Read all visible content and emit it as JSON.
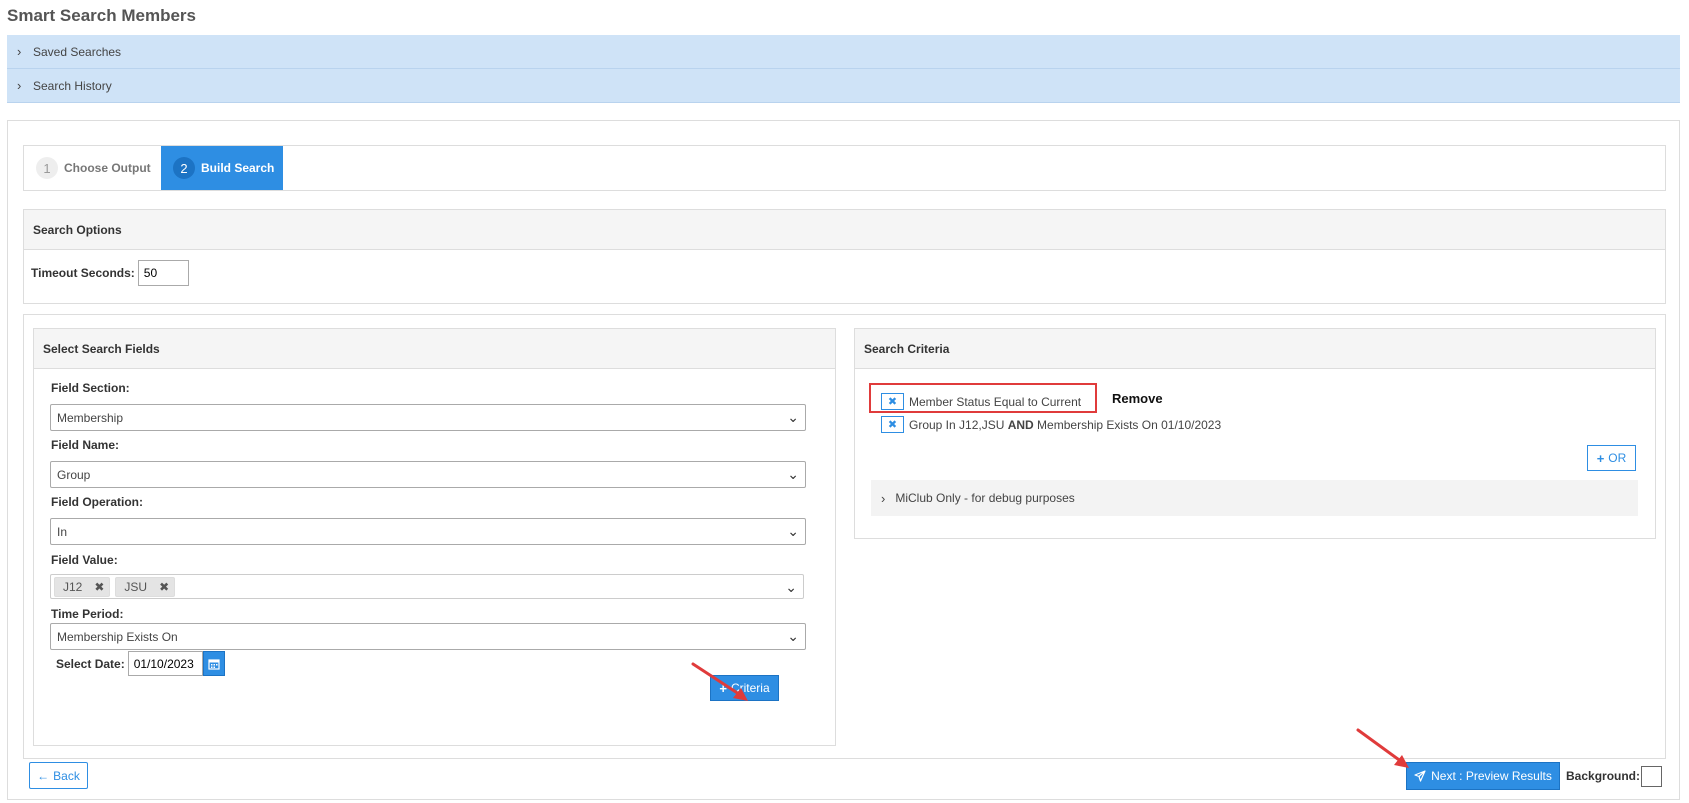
{
  "page": {
    "title": "Smart Search Members"
  },
  "accordions": [
    {
      "label": "Saved Searches"
    },
    {
      "label": "Search History"
    }
  ],
  "wizard": {
    "steps": [
      {
        "num": "1",
        "label": "Choose Output"
      },
      {
        "num": "2",
        "label": "Build Search"
      }
    ]
  },
  "search_options": {
    "title": "Search Options",
    "timeout_label": "Timeout Seconds:",
    "timeout_value": "50"
  },
  "fields": {
    "title": "Select Search Fields",
    "section_label": "Field Section:",
    "section_value": "Membership",
    "name_label": "Field Name:",
    "name_value": "Group",
    "operation_label": "Field Operation:",
    "operation_value": "In",
    "value_label": "Field Value:",
    "value_tags": [
      "J12",
      "JSU"
    ],
    "period_label": "Time Period:",
    "period_value": "Membership Exists On",
    "date_label": "Select Date:",
    "date_value": "01/10/2023",
    "criteria_button": "Criteria"
  },
  "criteria": {
    "title": "Search Criteria",
    "item1": "Member Status Equal to Current",
    "remove_label": "Remove",
    "item2_pre": "Group In J12,JSU ",
    "item2_and": "AND",
    "item2_post": " Membership Exists On 01/10/2023",
    "or_button": "OR",
    "debug_label": "MiClub Only - for debug purposes"
  },
  "footer": {
    "back_label": "Back",
    "next_label": "Next : Preview Results",
    "background_label": "Background:"
  },
  "colors": {
    "accent": "#2e8ee3",
    "accordion_bg": "#cfe3f7",
    "highlight": "#e03b3b"
  }
}
